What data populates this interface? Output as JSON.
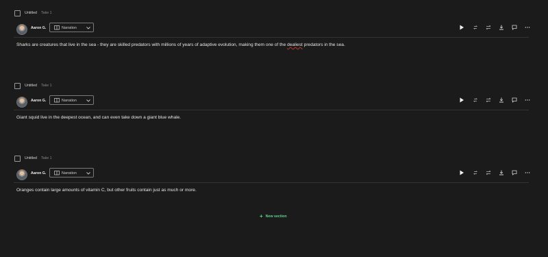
{
  "sections": [
    {
      "title": "Untitled",
      "take": "Take 1",
      "speaker": "Aaron G.",
      "style": "Narration",
      "text_before": "Sharks are creatures that live in the sea - they are skilled predators with millions of years of adaptive evolution, making them one of the ",
      "text_misspelled": "dealiest",
      "text_after": " predators in the sea."
    },
    {
      "title": "Untitled",
      "take": "Take 1",
      "speaker": "Aaron G.",
      "style": "Narration",
      "text_before": "Giant squid live in the deepest ocean, and can even take down a giant blue whale.",
      "text_misspelled": "",
      "text_after": ""
    },
    {
      "title": "Untitled",
      "take": "Take 1",
      "speaker": "Aaron G.",
      "style": "Narration",
      "text_before": "Oranges contain large amounts of vitamin C, but other fruits contain just as much or more.",
      "text_misspelled": "",
      "text_after": ""
    }
  ],
  "icons": [
    "play-icon",
    "regenerate-icon",
    "swap-icon",
    "download-icon",
    "comment-icon",
    "more-icon",
    "book-icon",
    "chevron-down-icon"
  ],
  "new_section_label": "New section",
  "colors": {
    "background": "#1b1b1b",
    "accent": "#5ed68b",
    "divider": "#333333"
  }
}
